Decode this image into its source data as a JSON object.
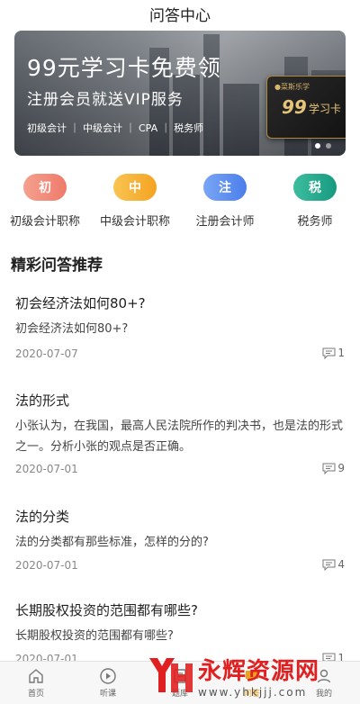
{
  "header": {
    "title": "问答中心"
  },
  "banner": {
    "title": "99元学习卡免费领",
    "subtitle": "注册会员就送VIP服务",
    "tags": "初级会计 ｜ 中级会计 ｜ CPA ｜ 税务师",
    "card": {
      "brand": "●菜斯乐学",
      "big": "99",
      "label": "学习卡"
    }
  },
  "categories": [
    {
      "icon_text": "初",
      "label": "初级会计职称",
      "color": "#f08a7c"
    },
    {
      "icon_text": "中",
      "label": "中级会计职称",
      "color": "#f6b43a"
    },
    {
      "icon_text": "注",
      "label": "注册会计师",
      "color": "#5d8ff0"
    },
    {
      "icon_text": "税",
      "label": "税务师",
      "color": "#27a78f"
    }
  ],
  "section": {
    "title": "精彩问答推荐"
  },
  "questions": [
    {
      "title": "初会经济法如何80+?",
      "desc": "初会经济法如何80+?",
      "date": "2020-07-07",
      "count": "1"
    },
    {
      "title": "法的形式",
      "desc": "小张认为，在我国，最高人民法院所作的判决书，也是法的形式之一。分析小张的观点是否正确。",
      "date": "2020-07-01",
      "count": "9"
    },
    {
      "title": "法的分类",
      "desc": "法的分类都有那些标准，怎样的分的?",
      "date": "2020-07-01",
      "count": "4"
    },
    {
      "title": "长期股权投资的范围都有哪些?",
      "desc": "长期股权投资的范围都有哪些?",
      "date": "2020-07-01",
      "count": "1"
    }
  ],
  "tabbar": [
    {
      "label": "首页",
      "icon": "home-icon"
    },
    {
      "label": "听课",
      "icon": "play-icon"
    },
    {
      "label": "题库",
      "icon": "book-icon"
    },
    {
      "label": "问答",
      "icon": "qa-icon"
    },
    {
      "label": "我的",
      "icon": "user-icon"
    }
  ],
  "watermark": {
    "text": "永辉资源网",
    "url": "www.yhkjjj.com"
  }
}
